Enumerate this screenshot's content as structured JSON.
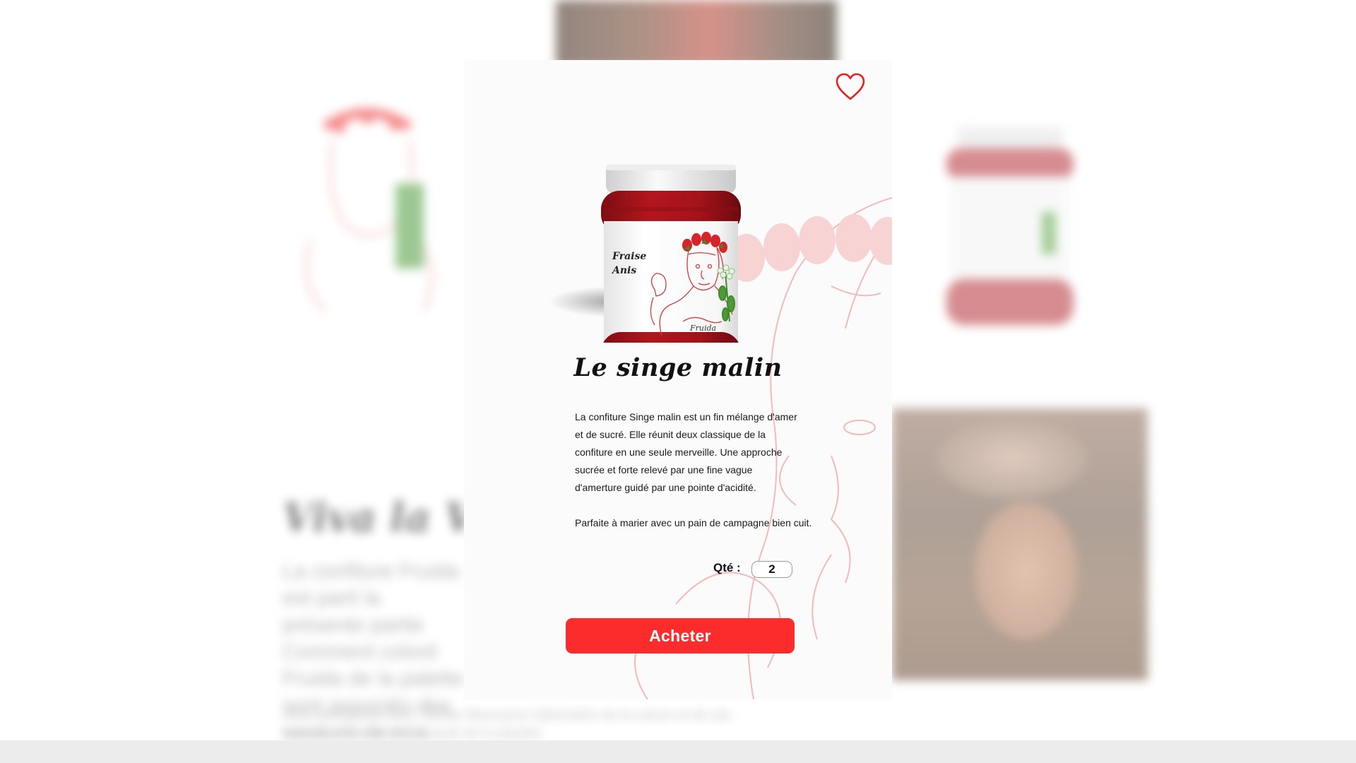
{
  "colors": {
    "accent": "#fd2c2c",
    "heart_outline": "#e52222",
    "modal_background": "#fbfbfb",
    "jam": "#a8141b",
    "lid": "#e8e8e8"
  },
  "background": {
    "heading": "Viva la Vida",
    "paragraph": "La confiture Fruida est parti la présente partie Comment coloré Fruida de la palette sont associés des saveurs de nos",
    "paragraph_2": "Nous partageons avec l'artiste Mexicaine l'admiration de la nature et de ses couleurs vives et de la beauté de la planète."
  },
  "modal": {
    "favorite_icon": "heart-outline",
    "product": {
      "title": "Le singe malin",
      "label_flavor_line1": "Fraise",
      "label_flavor_line2": "Anis",
      "label_brand": "Fruida",
      "description": "La confiture Singe malin est un fin mélange d'amer et de sucré. Elle réunit deux classique de la confiture en une seule merveille. Une approche sucrée et forte relevé par une fine vague d'amerture guidé par une pointe d'acidité.",
      "pairing": "Parfaite à marier avec un pain de campagne bien cuit."
    },
    "quantity": {
      "label": "Qté :",
      "value": "2"
    },
    "buy_button_label": "Acheter"
  }
}
